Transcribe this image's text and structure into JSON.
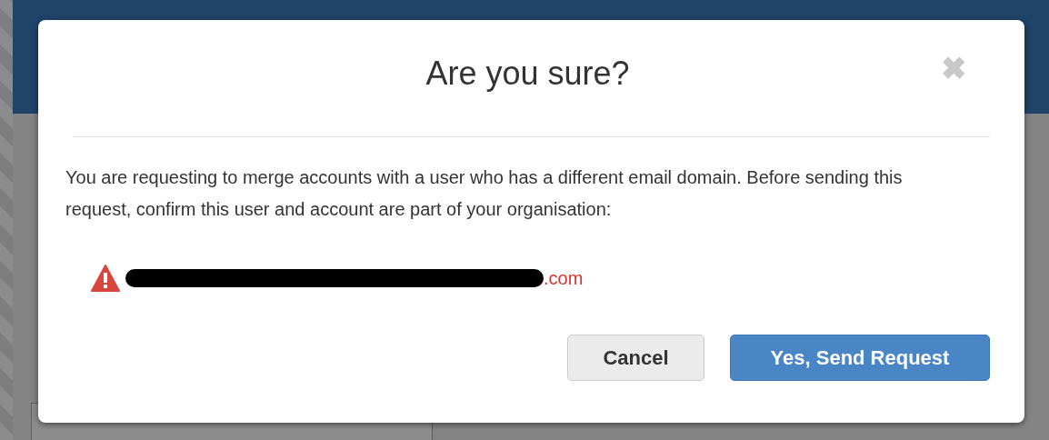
{
  "dialog": {
    "title": "Are you sure?",
    "close": "✖",
    "message": "You are requesting to merge accounts with a user who has a different email domain. Before sending this request, confirm this user and account are part of your organisation:",
    "warning": {
      "email_visible": ".com",
      "redacted": true
    },
    "buttons": [
      {
        "label": "Cancel",
        "kind": "secondary"
      },
      {
        "label": "Yes, Send Request",
        "kind": "primary"
      }
    ]
  }
}
